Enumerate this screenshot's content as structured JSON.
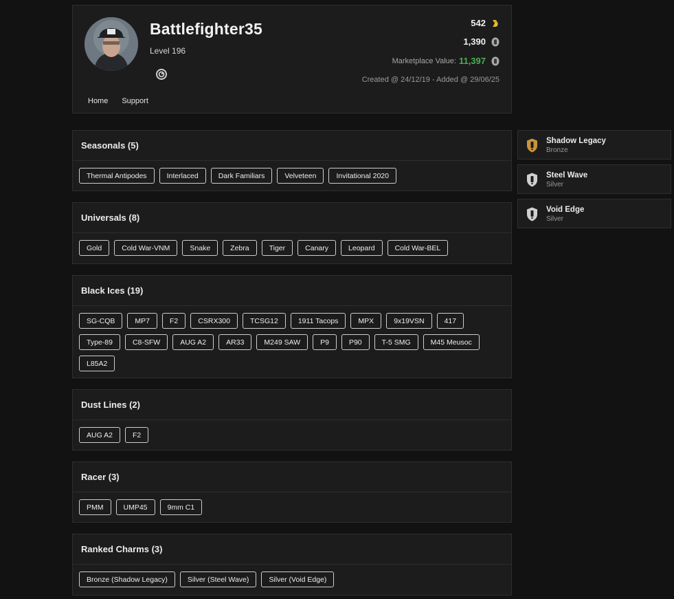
{
  "profile": {
    "username": "Battlefighter35",
    "level": "Level 196",
    "credits": "542",
    "renown": "1,390",
    "marketplace_label": "Marketplace Value:",
    "marketplace_value": "11,397",
    "created": "Created @ 24/12/19 - Added @ 29/06/25"
  },
  "nav": [
    {
      "label": "Home"
    },
    {
      "label": "Support"
    }
  ],
  "categories": [
    {
      "title": "Seasonals (5)",
      "items": [
        "Thermal Antipodes",
        "Interlaced",
        "Dark Familiars",
        "Velveteen",
        "Invitational 2020"
      ]
    },
    {
      "title": "Universals (8)",
      "items": [
        "Gold",
        "Cold War-VNM",
        "Snake",
        "Zebra",
        "Tiger",
        "Canary",
        "Leopard",
        "Cold War-BEL"
      ]
    },
    {
      "title": "Black Ices (19)",
      "items": [
        "SG-CQB",
        "MP7",
        "F2",
        "CSRX300",
        "TCSG12",
        "1911 Tacops",
        "MPX",
        "9x19VSN",
        "417",
        "Type-89",
        "C8-SFW",
        "AUG A2",
        "AR33",
        "M249 SAW",
        "P9",
        "P90",
        "T-5 SMG",
        "M45 Meusoc",
        "L85A2"
      ]
    },
    {
      "title": "Dust Lines (2)",
      "items": [
        "AUG A2",
        "F2"
      ]
    },
    {
      "title": "Racer (3)",
      "items": [
        "PMM",
        "UMP45",
        "9mm C1"
      ]
    },
    {
      "title": "Ranked Charms (3)",
      "items": [
        "Bronze (Shadow Legacy)",
        "Silver (Steel Wave)",
        "Silver (Void Edge)"
      ]
    }
  ],
  "ranked": [
    {
      "name": "Shadow Legacy",
      "tier": "Bronze",
      "color": "#c8953a"
    },
    {
      "name": "Steel Wave",
      "tier": "Silver",
      "color": "#cfcfcf"
    },
    {
      "name": "Void Edge",
      "tier": "Silver",
      "color": "#cfcfcf"
    }
  ],
  "colors": {
    "credits_coin": "#d4b01e",
    "marketplace_value": "#4caf50"
  }
}
